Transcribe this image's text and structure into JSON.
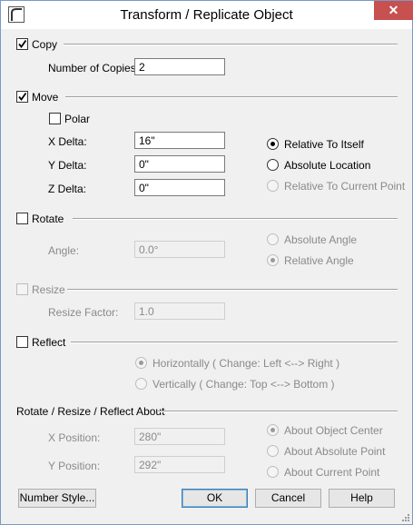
{
  "window": {
    "title": "Transform / Replicate Object",
    "close_glyph": "✕"
  },
  "copy": {
    "label": "Copy",
    "checked": true,
    "num_copies_label": "Number of Copies:",
    "num_copies_value": "2"
  },
  "move": {
    "label": "Move",
    "checked": true,
    "polar_label": "Polar",
    "x_label": "X Delta:",
    "x_value": "16\"",
    "y_label": "Y Delta:",
    "y_value": "0\"",
    "z_label": "Z Delta:",
    "z_value": "0\"",
    "relative_itself": "Relative To Itself",
    "absolute_location": "Absolute Location",
    "relative_current_point": "Relative To Current Point"
  },
  "rotate": {
    "label": "Rotate",
    "angle_label": "Angle:",
    "angle_value": "0.0°",
    "absolute_angle": "Absolute Angle",
    "relative_angle": "Relative Angle"
  },
  "resize": {
    "label": "Resize",
    "factor_label": "Resize Factor:",
    "factor_value": "1.0"
  },
  "reflect": {
    "label": "Reflect",
    "horizontally": "Horizontally ( Change: Left <--> Right )",
    "vertically": "Vertically ( Change: Top <--> Bottom )"
  },
  "about": {
    "label": "Rotate / Resize / Reflect About",
    "x_label": "X Position:",
    "x_value": "280\"",
    "y_label": "Y Position:",
    "y_value": "292\"",
    "object_center": "About Object Center",
    "absolute_point": "About Absolute Point",
    "current_point": "About Current Point"
  },
  "buttons": {
    "number_style": "Number Style...",
    "ok": "OK",
    "cancel": "Cancel",
    "help": "Help"
  },
  "colors": {
    "accent": "#3c7fb1",
    "close": "#c75050",
    "disabled_text": "#8a8a8a"
  }
}
